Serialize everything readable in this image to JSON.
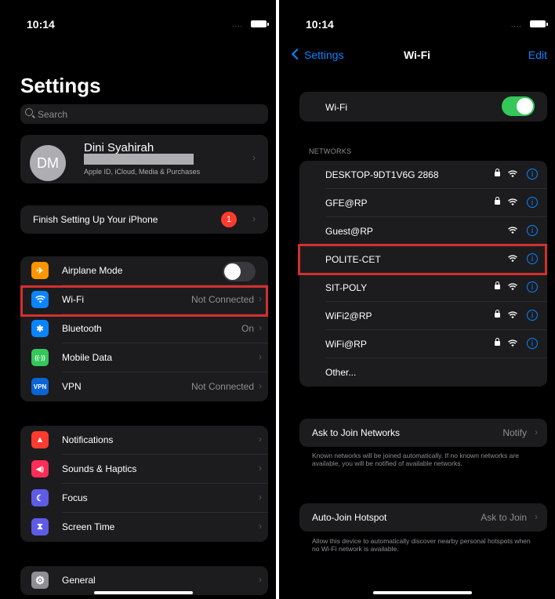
{
  "status": {
    "time": "10:14",
    "signal_dots": "....",
    "left_time": "10:14",
    "right_time": "10:14"
  },
  "settings": {
    "title": "Settings",
    "search_placeholder": "Search",
    "profile": {
      "initials": "DM",
      "name": "Dini Syahirah",
      "subtitle": "Apple ID, iCloud, Media & Purchases"
    },
    "finish_setup": {
      "label": "Finish Setting Up Your iPhone",
      "badge": "1"
    },
    "connectivity": [
      {
        "label": "Airplane Mode",
        "value": "",
        "icon": "airplane-icon",
        "color": "#ff9500",
        "glyph": "✈",
        "toggle": "off"
      },
      {
        "label": "Wi-Fi",
        "value": "Not Connected",
        "icon": "wifi-icon",
        "color": "#0a84ff",
        "glyph": "",
        "highlighted": true
      },
      {
        "label": "Bluetooth",
        "value": "On",
        "icon": "bluetooth-icon",
        "color": "#0a84ff",
        "glyph": "✱"
      },
      {
        "label": "Mobile Data",
        "value": "",
        "icon": "antenna-icon",
        "color": "#34c759",
        "glyph": "((·))"
      },
      {
        "label": "VPN",
        "value": "Not Connected",
        "icon": "vpn-icon",
        "color": "#0a64d6",
        "glyph": "VPN"
      }
    ],
    "notifications": [
      {
        "label": "Notifications",
        "icon": "bell-icon",
        "color": "#ff3b30",
        "glyph": "▲"
      },
      {
        "label": "Sounds & Haptics",
        "icon": "speaker-icon",
        "color": "#ff2d55",
        "glyph": "◀)"
      },
      {
        "label": "Focus",
        "icon": "moon-icon",
        "color": "#5e5ce6",
        "glyph": "☾"
      },
      {
        "label": "Screen Time",
        "icon": "hourglass-icon",
        "color": "#5e5ce6",
        "glyph": "⧗"
      }
    ],
    "general": {
      "label": "General",
      "icon": "gear-icon",
      "color": "#8e8e93",
      "glyph": "⚙"
    }
  },
  "wifi": {
    "back_label": "Settings",
    "title": "Wi-Fi",
    "edit_label": "Edit",
    "toggle_label": "Wi-Fi",
    "toggle_state": "on",
    "networks_header": "NETWORKS",
    "networks": [
      {
        "name": "DESKTOP-9DT1V6G 2868",
        "locked": true
      },
      {
        "name": "GFE@RP",
        "locked": true
      },
      {
        "name": "Guest@RP",
        "locked": false
      },
      {
        "name": "POLITE-CET",
        "locked": false,
        "highlighted": true
      },
      {
        "name": "SIT-POLY",
        "locked": true
      },
      {
        "name": "WiFi2@RP",
        "locked": true
      },
      {
        "name": "WiFi@RP",
        "locked": true
      }
    ],
    "other_label": "Other...",
    "ask_to_join": {
      "label": "Ask to Join Networks",
      "value": "Notify",
      "note": "Known networks will be joined automatically. If no known networks are available, you will be notified of available networks."
    },
    "auto_join": {
      "label": "Auto-Join Hotspot",
      "value": "Ask to Join",
      "note": "Allow this device to automatically discover nearby personal hotspots when no Wi-Fi network is available."
    }
  },
  "colors": {
    "highlight": "#d32f2f",
    "accent": "#0a84ff",
    "toggle_on": "#34c759",
    "badge": "#ff3b30"
  }
}
